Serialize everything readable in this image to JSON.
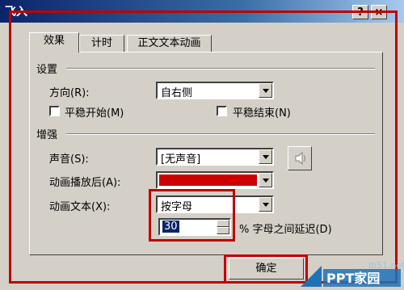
{
  "window": {
    "title": "飞入",
    "help_label": "?",
    "close_label": "×"
  },
  "tabs": [
    {
      "label": "效果"
    },
    {
      "label": "计时"
    },
    {
      "label": "正文文本动画"
    }
  ],
  "settings": {
    "group_label": "设置",
    "direction_label": "方向(R):",
    "direction_value": "自右侧",
    "smooth_start_label": "平稳开始(M)",
    "smooth_end_label": "平稳结束(N)"
  },
  "enhance": {
    "group_label": "增强",
    "sound_label": "声音(S):",
    "sound_value": "[无声音]",
    "after_anim_label": "动画播放后(A):",
    "after_anim_color": "#cc0000",
    "anim_text_label": "动画文本(X):",
    "anim_text_value": "按字母",
    "delay_value": "30",
    "delay_suffix": "% 字母之间延迟(D)"
  },
  "buttons": {
    "ok_label": "确定"
  },
  "watermark": {
    "text": "PPT家园",
    "url": "ib51.net"
  },
  "colors": {
    "highlight": "#c00000"
  }
}
